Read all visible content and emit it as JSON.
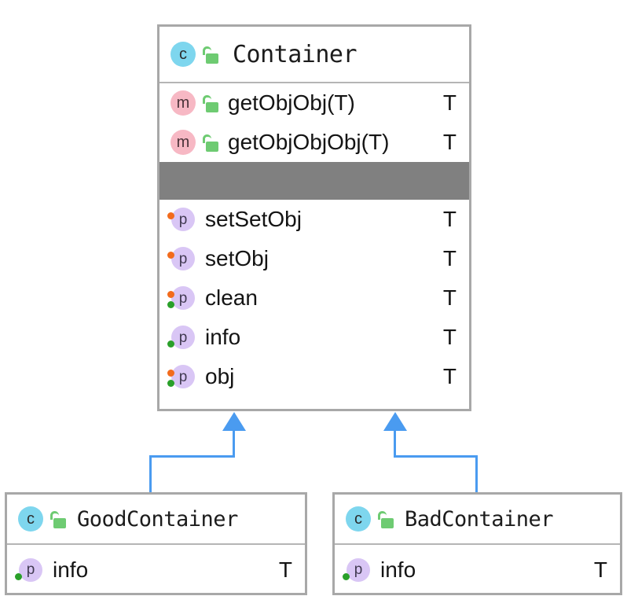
{
  "diagram": {
    "type": "uml-class-diagram",
    "colors": {
      "box_border": "#a8a8a8",
      "separator_band": "#808080",
      "connector": "#4a9bf0",
      "badge_class": "#7ed6ee",
      "badge_method": "#f7b8c4",
      "badge_property": "#d9c6f5",
      "lock_open": "#6ecb72",
      "dot_orange": "#f26b1d",
      "dot_green": "#2aa02a"
    }
  },
  "classes": {
    "container": {
      "name": "Container",
      "kind_badge": "c",
      "visibility_icon": "unlocked-padlock-icon",
      "methods": [
        {
          "badge": "m",
          "name": "getObjObj(T)",
          "type": "T"
        },
        {
          "badge": "m",
          "name": "getObjObjObj(T)",
          "type": "T"
        }
      ],
      "properties": [
        {
          "badge": "p",
          "name": "setSetObj",
          "type": "T",
          "dots": [
            "orange"
          ]
        },
        {
          "badge": "p",
          "name": "setObj",
          "type": "T",
          "dots": [
            "orange"
          ]
        },
        {
          "badge": "p",
          "name": "clean",
          "type": "T",
          "dots": [
            "orange",
            "green"
          ]
        },
        {
          "badge": "p",
          "name": "info",
          "type": "T",
          "dots": [
            "green"
          ]
        },
        {
          "badge": "p",
          "name": "obj",
          "type": "T",
          "dots": [
            "orange",
            "green"
          ]
        }
      ]
    },
    "good_container": {
      "name": "GoodContainer",
      "kind_badge": "c",
      "visibility_icon": "unlocked-padlock-icon",
      "properties": [
        {
          "badge": "p",
          "name": "info",
          "type": "T",
          "dots": [
            "green"
          ]
        }
      ]
    },
    "bad_container": {
      "name": "BadContainer",
      "kind_badge": "c",
      "visibility_icon": "unlocked-padlock-icon",
      "properties": [
        {
          "badge": "p",
          "name": "info",
          "type": "T",
          "dots": [
            "green"
          ]
        }
      ]
    }
  },
  "relationships": [
    {
      "type": "generalization",
      "from": "GoodContainer",
      "to": "Container"
    },
    {
      "type": "generalization",
      "from": "BadContainer",
      "to": "Container"
    }
  ]
}
